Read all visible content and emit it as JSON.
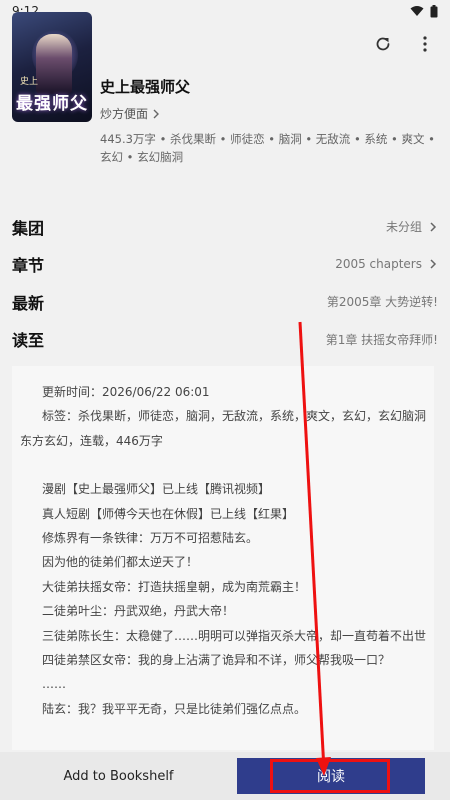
{
  "status_bar": {
    "time": "9:12",
    "icons": [
      "wifi-icon",
      "battery-icon"
    ]
  },
  "toolbar": {
    "back_icon": "arrow-left-icon",
    "refresh_icon": "refresh-icon",
    "more_icon": "more-vert-icon"
  },
  "book": {
    "cover_title": "最强师父",
    "cover_tag": "史上",
    "title": "史上最强师父",
    "author": "炒方便面",
    "meta": "445.3万字 • 杀伐果断 • 师徒恋 • 脑洞 • 无敌流 • 系统 • 爽文 • 玄幻 • 玄幻脑洞"
  },
  "info_rows": [
    {
      "label": "集团",
      "value": "未分组",
      "chevron": true
    },
    {
      "label": "章节",
      "value": "2005 chapters",
      "chevron": true
    },
    {
      "label": "最新",
      "value": "第2005章 大势逆转!",
      "chevron": false
    },
    {
      "label": "读至",
      "value": "第1章 扶摇女帝拜师!",
      "chevron": false
    }
  ],
  "description": {
    "update_time": "更新时间：2026/06/22 06:01",
    "tags_line1": "标签：杀伐果断，师徒恋，脑洞，无敌流，系统，爽文，玄幻，玄幻脑洞，",
    "tags_line2": "东方玄幻，连载，446万字",
    "lines": [
      "漫剧【史上最强师父】已上线【腾讯视频】",
      "真人短剧【师傅今天也在休假】已上线【红果】",
      "修炼界有一条铁律：万万不可招惹陆玄。",
      "因为他的徒弟们都太逆天了！",
      "大徒弟扶摇女帝：打造扶摇皇朝，成为南荒霸主！",
      "二徒弟叶尘：丹武双绝，丹武大帝！",
      "三徒弟陈长生：太稳健了……明明可以弹指灭杀大帝，却一直苟着不出世！",
      "四徒弟禁区女帝：我的身上沾满了诡异和不详，师父帮我吸一口？",
      "……",
      "陆玄：我？我平平无奇，只是比徒弟们强亿点点。"
    ]
  },
  "bottom_bar": {
    "bookshelf_label": "Add to Bookshelf",
    "read_label": "阅读"
  },
  "colors": {
    "primary": "#2f3d8c",
    "highlight": "#ee1111",
    "background": "#f1f1f1"
  }
}
